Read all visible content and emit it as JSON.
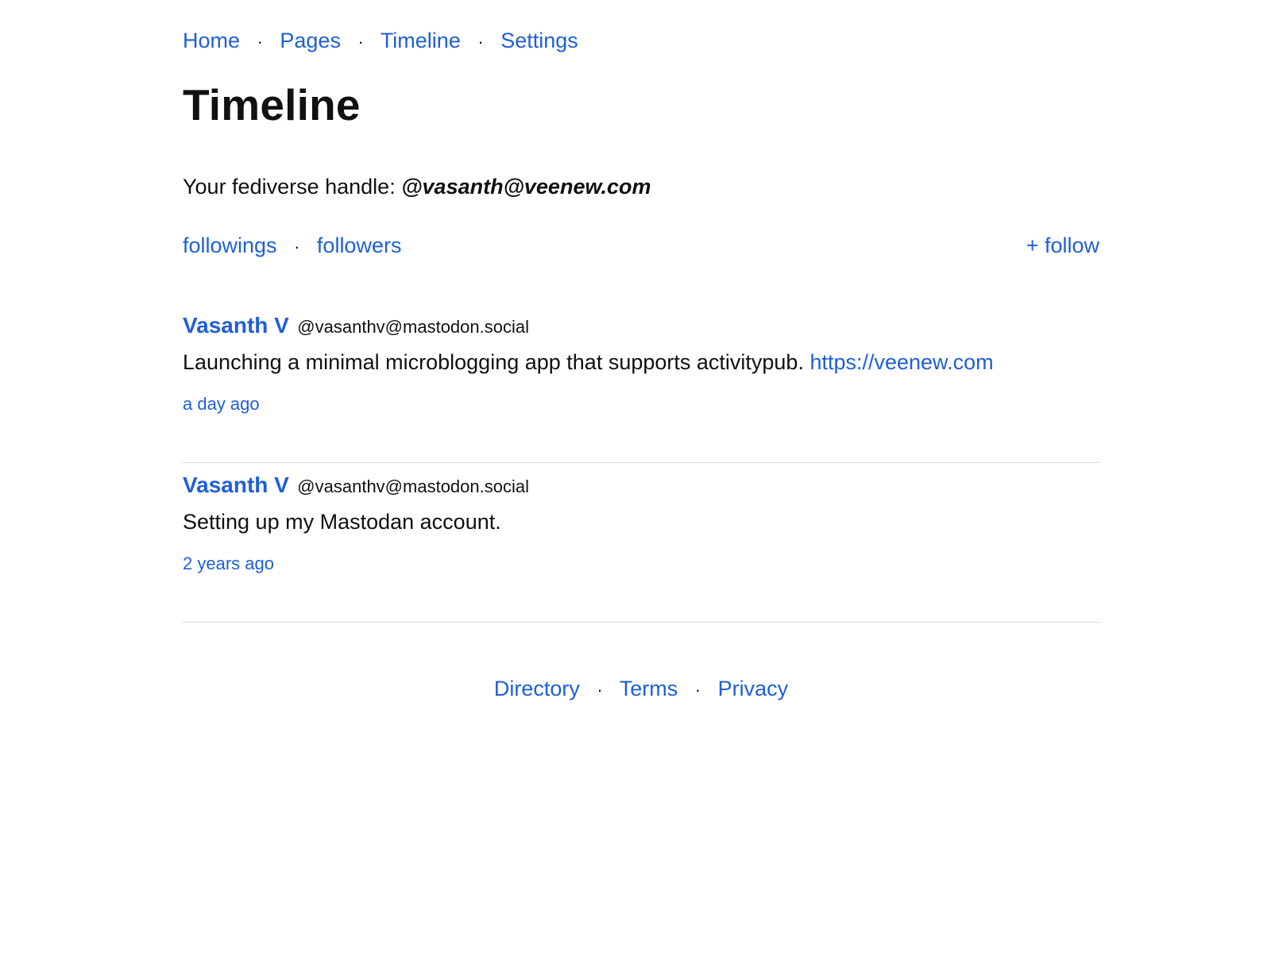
{
  "nav": {
    "items": [
      {
        "label": "Home"
      },
      {
        "label": "Pages"
      },
      {
        "label": "Timeline"
      },
      {
        "label": "Settings"
      }
    ],
    "separator": "·"
  },
  "page": {
    "title": "Timeline"
  },
  "profile": {
    "handle_label": "Your fediverse handle: ",
    "handle": "@vasanth@veenew.com"
  },
  "follow": {
    "followings": "followings",
    "followers": "followers",
    "add_follow": "+ follow"
  },
  "posts": [
    {
      "author": "Vasanth V",
      "account": "@vasanthv@mastodon.social",
      "text": "Launching a minimal microblogging app that supports activitypub. ",
      "link": "https://veenew.com",
      "time": "a day ago"
    },
    {
      "author": "Vasanth V",
      "account": "@vasanthv@mastodon.social",
      "text": "Setting up my Mastodan account.",
      "link": "",
      "time": "2 years ago"
    }
  ],
  "footer": {
    "items": [
      {
        "label": "Directory"
      },
      {
        "label": "Terms"
      },
      {
        "label": "Privacy"
      }
    ]
  },
  "colors": {
    "link": "#1f5fd6",
    "text": "#111111",
    "divider": "#d9d9d9",
    "background": "#ffffff"
  }
}
